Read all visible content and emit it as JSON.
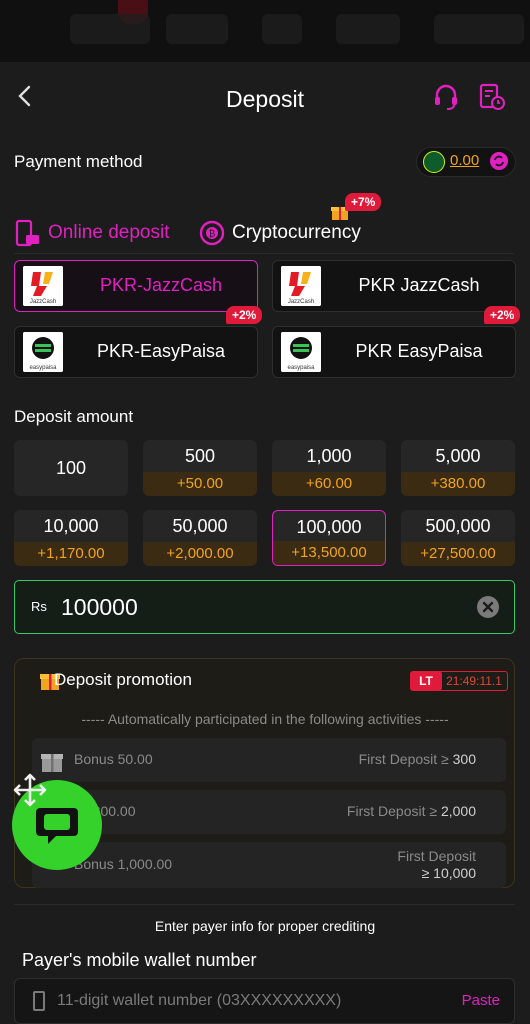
{
  "header": {
    "title": "Deposit"
  },
  "payment_method": {
    "label": "Payment method",
    "balance": "0.00"
  },
  "tabs": [
    {
      "label": "Online deposit",
      "active": true
    },
    {
      "label": "Cryptocurrency",
      "badge": "+7%"
    }
  ],
  "methods": [
    {
      "label": "PKR-JazzCash",
      "logo": "JazzCash",
      "selected": true
    },
    {
      "label": "PKR JazzCash",
      "logo": "JazzCash"
    },
    {
      "label": "PKR-EasyPaisa",
      "logo": "easypaisa",
      "badge": "+2%"
    },
    {
      "label": "PKR EasyPaisa",
      "logo": "easypaisa",
      "badge": "+2%"
    }
  ],
  "deposit_amount": {
    "label": "Deposit amount",
    "options": [
      {
        "value": "100",
        "bonus": ""
      },
      {
        "value": "500",
        "bonus": "+50.00"
      },
      {
        "value": "1,000",
        "bonus": "+60.00"
      },
      {
        "value": "5,000",
        "bonus": "+380.00"
      },
      {
        "value": "10,000",
        "bonus": "+1,170.00"
      },
      {
        "value": "50,000",
        "bonus": "+2,000.00"
      },
      {
        "value": "100,000",
        "bonus": "+13,500.00",
        "selected": true
      },
      {
        "value": "500,000",
        "bonus": "+27,500.00"
      }
    ],
    "currency": "Rs",
    "input_value": "100000"
  },
  "promotion": {
    "title": "Deposit promotion",
    "lt": "LT",
    "timer": "21:49:11.1",
    "note": "Automatically participated in the following activities",
    "rows": [
      {
        "bonus": "Bonus 50.00",
        "condition": "First Deposit ≥",
        "amount": "300"
      },
      {
        "bonus": "us 300.00",
        "condition": "First Deposit ≥",
        "amount": "2,000"
      },
      {
        "bonus": "Bonus 1,000.00",
        "condition": "First Deposit",
        "amount": "≥ 10,000"
      }
    ]
  },
  "payer": {
    "note": "Enter payer info for proper crediting",
    "label": "Payer's mobile wallet number",
    "placeholder": "11-digit wallet number (03XXXXXXXXX)",
    "paste": "Paste"
  },
  "colors": {
    "accent": "#e020c0",
    "bonus": "#f2a31f",
    "input_border": "#36c86a",
    "chat": "#35d22b"
  }
}
